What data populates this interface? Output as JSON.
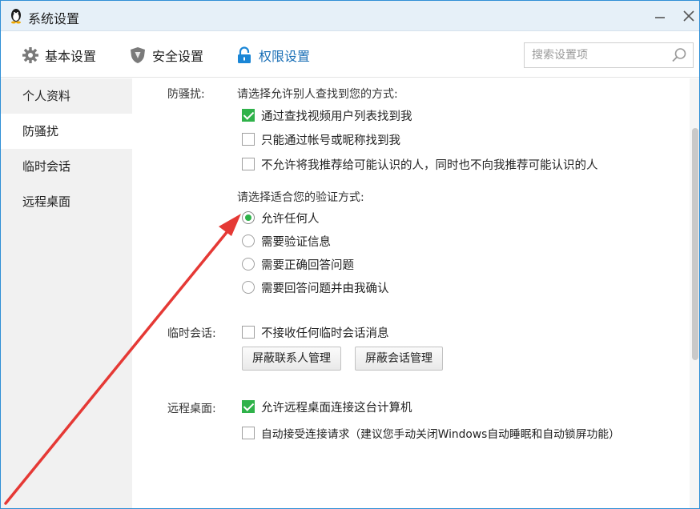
{
  "window": {
    "title": "系统设置"
  },
  "toolbar": {
    "tabs": [
      {
        "label": "基本设置",
        "icon": "gear-icon"
      },
      {
        "label": "安全设置",
        "icon": "shield-icon"
      },
      {
        "label": "权限设置",
        "icon": "lock-icon",
        "active": true
      }
    ],
    "search_placeholder": "搜索设置项"
  },
  "sidebar": {
    "items": [
      {
        "label": "个人资料"
      },
      {
        "label": "防骚扰",
        "active": true
      },
      {
        "label": "临时会话"
      },
      {
        "label": "远程桌面"
      }
    ]
  },
  "harass": {
    "label": "防骚扰:",
    "find_prompt": "请选择允许别人查找到您的方式:",
    "find_options": [
      {
        "label": "通过查找视频用户列表找到我",
        "checked": true
      },
      {
        "label": "只能通过帐号或昵称找到我",
        "checked": false
      },
      {
        "label": "不允许将我推荐给可能认识的人，同时也不向我推荐可能认识的人",
        "checked": false
      }
    ],
    "verify_prompt": "请选择适合您的验证方式:",
    "verify_options": [
      {
        "label": "允许任何人",
        "selected": true
      },
      {
        "label": "需要验证信息",
        "selected": false
      },
      {
        "label": "需要正确回答问题",
        "selected": false
      },
      {
        "label": "需要回答问题并由我确认",
        "selected": false
      }
    ]
  },
  "temp_session": {
    "label": "临时会话:",
    "option": {
      "label": "不接收任何临时会话消息",
      "checked": false
    },
    "buttons": {
      "block_contacts": "屏蔽联系人管理",
      "block_sessions": "屏蔽会话管理"
    }
  },
  "remote_desktop": {
    "label": "远程桌面:",
    "options": [
      {
        "label": "允许远程桌面连接这台计算机",
        "checked": true
      },
      {
        "label": "自动接受连接请求（建议您手动关闭Windows自动睡眠和自动锁屏功能）",
        "checked": false
      }
    ]
  },
  "colors": {
    "accent": "#1a6fb6",
    "check_green": "#2fb24a",
    "annotation_arrow": "#e53935"
  }
}
